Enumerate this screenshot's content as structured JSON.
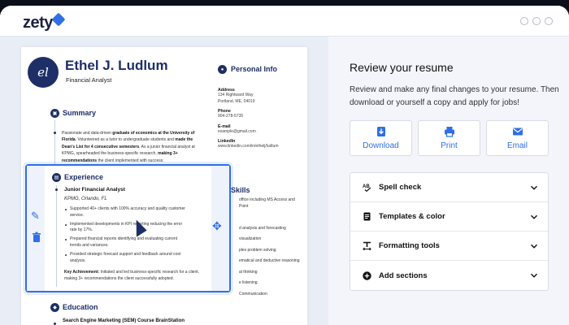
{
  "brand": {
    "name": "zety"
  },
  "resume": {
    "avatar_initials": "el",
    "name": "Ethel J. Ludlum",
    "title": "Financial Analyst",
    "summary": {
      "heading": "Summary",
      "text_1": "Passionate and data-driven ",
      "text_1b": "graduate of economics at the University of Florida",
      "text_2": ". Volunteered as a tutor to undergraduate students and ",
      "text_2b": "made the Dean's List for 4 consecutive semesters",
      "text_3": ". As a junior financial analyst at KPMG, spearheaded the business-specific research, ",
      "text_3b": "making 3+ recommendations",
      "text_4": " the client implemented with success."
    },
    "personal_info": {
      "heading": "Personal Info",
      "address_label": "Address",
      "address_line1": "134 Rightward Way",
      "address_line2": "Portland, ME, 04019",
      "phone_label": "Phone",
      "phone": "904-278-5735",
      "email_label": "E-mail",
      "email": "example@gmail.com",
      "linkedin_label": "LinkedIn",
      "linkedin": "www.linkedin.com/in/ethelj/ludlum"
    },
    "skills": {
      "heading": "Skills",
      "items": [
        "office including MS Access and",
        "Point",
        "",
        "d analysis and forecasting",
        "visualization",
        "plex problem solving",
        "ematical and deductive reasoning",
        "al thinking",
        "e listening",
        "Communication"
      ]
    },
    "experience": {
      "heading": "Experience",
      "role": "Junior Financial Analyst",
      "company": "KPMG, Orlando, FL",
      "bullets": [
        "Supported 40+ clients with 100% accuracy and quality customer service.",
        "Implemented developments in KPI reporting reducing the error rate by 17%.",
        "Prepared financial reports identifying and evaluating current trends and variances.",
        "Provided strategic forecast support and feedback around cost analysis."
      ],
      "key_label": "Key Achievement:",
      "key_text": " Initiated and led business-specific research for a client, making 3+ recommendations the client successfully adopted."
    },
    "education": {
      "heading": "Education",
      "item": "Search Engine Marketing (SEM) Course BrainStation"
    }
  },
  "panel": {
    "title": "Review your resume",
    "description": "Review and make any final changes to your resume. Then download or yourself a copy and apply for jobs!",
    "actions": [
      {
        "label": "Download",
        "icon": "download-icon"
      },
      {
        "label": "Print",
        "icon": "printer-icon"
      },
      {
        "label": "Email",
        "icon": "envelope-icon"
      }
    ],
    "accordion": [
      {
        "label": "Spell check",
        "icon": "spell-check-icon"
      },
      {
        "label": "Templates & color",
        "icon": "document-icon"
      },
      {
        "label": "Formatting tools",
        "icon": "text-format-icon"
      },
      {
        "label": "Add sections",
        "icon": "plus-circle-icon"
      }
    ]
  },
  "colors": {
    "accent": "#2f6fe6",
    "navy": "#1d2f66",
    "panel_bg": "#f3f5fa"
  }
}
